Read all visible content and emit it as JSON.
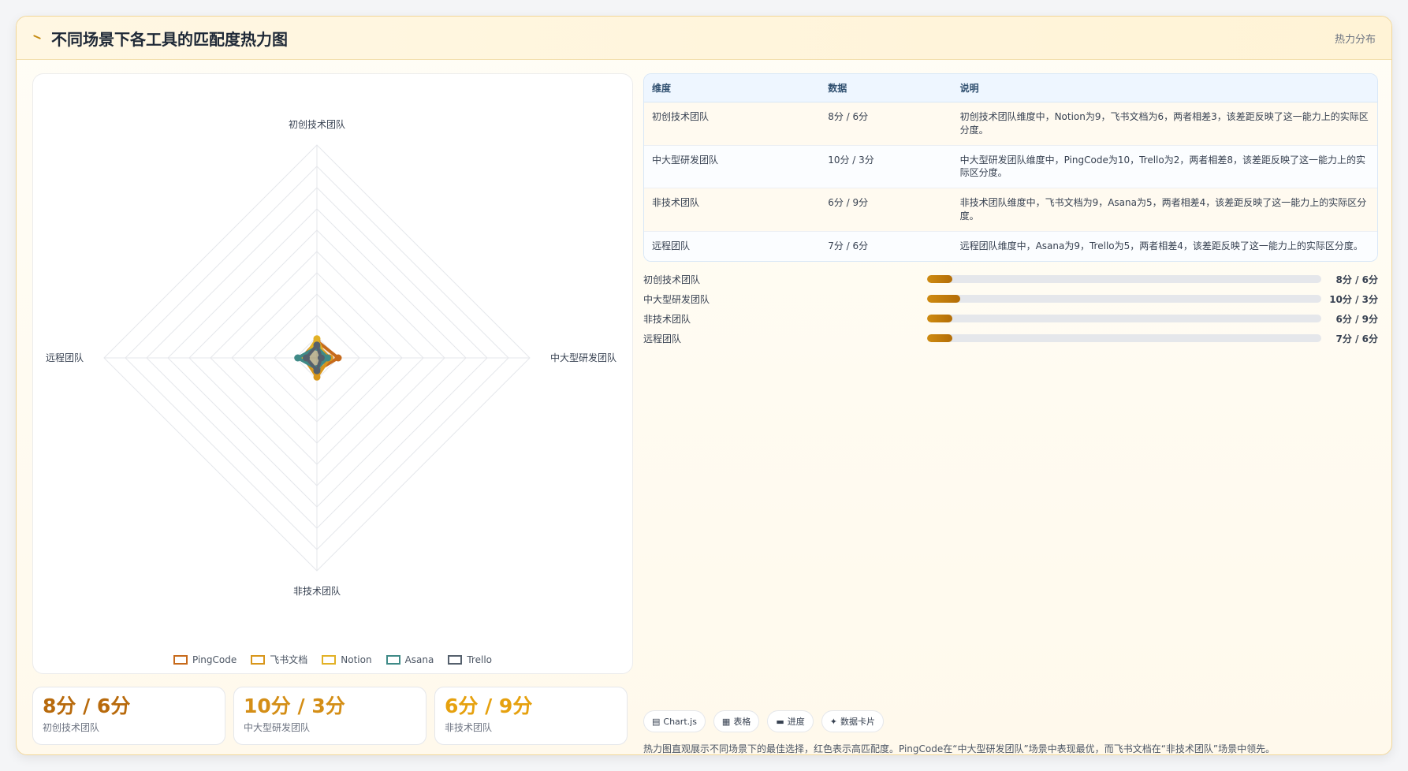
{
  "header": {
    "title": "不同场景下各工具的匹配度热力图",
    "tag": "热力分布"
  },
  "table": {
    "columns": [
      "维度",
      "数据",
      "说明"
    ],
    "rows": [
      {
        "dimension": "初创技术团队",
        "data": "8分 / 6分",
        "description": "初创技术团队维度中，Notion为9，飞书文档为6，两者相差3，该差距反映了这一能力上的实际区分度。"
      },
      {
        "dimension": "中大型研发团队",
        "data": "10分 / 3分",
        "description": "中大型研发团队维度中，PingCode为10，Trello为2，两者相差8，该差距反映了这一能力上的实际区分度。"
      },
      {
        "dimension": "非技术团队",
        "data": "6分 / 9分",
        "description": "非技术团队维度中，飞书文档为9，Asana为5，两者相差4，该差距反映了这一能力上的实际区分度。"
      },
      {
        "dimension": "远程团队",
        "data": "7分 / 6分",
        "description": "远程团队维度中，Asana为9，Trello为5，两者相差4，该差距反映了这一能力上的实际区分度。"
      }
    ]
  },
  "progress": [
    {
      "label": "初创技术团队",
      "value_text": "8分 / 6分",
      "fraction": 0.063
    },
    {
      "label": "中大型研发团队",
      "value_text": "10分 / 3分",
      "fraction": 0.083
    },
    {
      "label": "非技术团队",
      "value_text": "6分 / 9分",
      "fraction": 0.063
    },
    {
      "label": "远程团队",
      "value_text": "7分 / 6分",
      "fraction": 0.063
    }
  ],
  "stats": [
    {
      "value": "8分 / 6分",
      "label": "初创技术团队",
      "color": "#b86a0c"
    },
    {
      "value": "10分 / 3分",
      "label": "中大型研发团队",
      "color": "#d48e16"
    },
    {
      "value": "6分 / 9分",
      "label": "非技术团队",
      "color": "#e6a10e"
    }
  ],
  "chips": [
    {
      "icon": "chart-icon",
      "glyph": "▤",
      "label": "Chart.js"
    },
    {
      "icon": "table-icon",
      "glyph": "▦",
      "label": "表格"
    },
    {
      "icon": "progress-icon",
      "glyph": "▬",
      "label": "进度"
    },
    {
      "icon": "data-card-icon",
      "glyph": "✦",
      "label": "数据卡片"
    }
  ],
  "footnote": "热力图直观展示不同场景下的最佳选择，红色表示高匹配度。PingCode在“中大型研发团队”场景中表现最优，而飞书文档在“非技术团队”场景中领先。",
  "chart_data": {
    "type": "radar",
    "title": "",
    "xlabel": "",
    "ylabel": "",
    "axes": [
      "初创技术团队",
      "中大型研发团队",
      "非技术团队",
      "远程团队"
    ],
    "rlim": [
      0,
      100
    ],
    "grid": true,
    "legend_position": "bottom",
    "series": [
      {
        "name": "PingCode",
        "values": [
          8,
          10,
          6,
          7
        ],
        "color": "#c76a1b"
      },
      {
        "name": "飞书文档",
        "values": [
          6,
          6,
          9,
          6
        ],
        "color": "#d8961b"
      },
      {
        "name": "Notion",
        "values": [
          9,
          4,
          6,
          6
        ],
        "color": "#e2b126"
      },
      {
        "name": "Asana",
        "values": [
          5,
          5,
          5,
          9
        ],
        "color": "#3f8a87"
      },
      {
        "name": "Trello",
        "values": [
          6,
          2,
          6,
          5
        ],
        "color": "#55606d"
      }
    ]
  }
}
